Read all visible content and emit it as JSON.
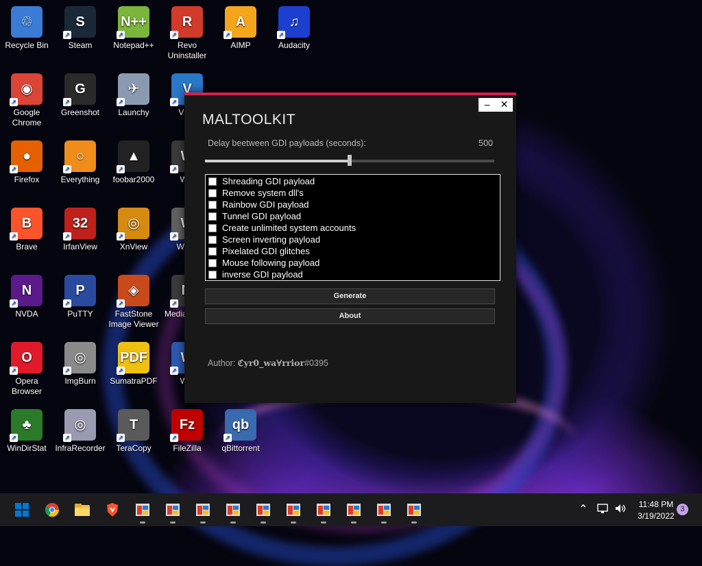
{
  "desktop": {
    "icons": [
      {
        "label": "Recycle Bin",
        "symbol": "♲",
        "color": "#3a7bd5"
      },
      {
        "label": "Steam",
        "symbol": "S",
        "color": "#1b2838"
      },
      {
        "label": "Notepad++",
        "symbol": "N++",
        "color": "#7bb53b"
      },
      {
        "label": "Revo Uninstaller",
        "symbol": "R",
        "color": "#d23a2a"
      },
      {
        "label": "AIMP",
        "symbol": "A",
        "color": "#f4a51c"
      },
      {
        "label": "Audacity",
        "symbol": "♫",
        "color": "#1d3fd0"
      },
      {
        "label": "Google Chrome",
        "symbol": "◉",
        "color": "#db4437"
      },
      {
        "label": "Greenshot",
        "symbol": "G",
        "color": "#2a2a2a"
      },
      {
        "label": "Launchy",
        "symbol": "✈",
        "color": "#8a9ab0"
      },
      {
        "label": "VNC",
        "symbol": "V",
        "color": "#2a78c8"
      },
      {
        "label": "Firefox",
        "symbol": "●",
        "color": "#e66000"
      },
      {
        "label": "Everything",
        "symbol": "○",
        "color": "#f08c1a"
      },
      {
        "label": "foobar2000",
        "symbol": "▲",
        "color": "#222222"
      },
      {
        "label": "Win",
        "symbol": "W",
        "color": "#3a3a3a"
      },
      {
        "label": "Brave",
        "symbol": "B",
        "color": "#fb542b"
      },
      {
        "label": "IrfanView",
        "symbol": "32",
        "color": "#c0201a"
      },
      {
        "label": "XnView",
        "symbol": "◎",
        "color": "#d58a10"
      },
      {
        "label": "WinM",
        "symbol": "W",
        "color": "#606060"
      },
      {
        "label": "NVDA",
        "symbol": "N",
        "color": "#5a1a8a"
      },
      {
        "label": "PuTTY",
        "symbol": "P",
        "color": "#2a4aa0"
      },
      {
        "label": "FastStone Image Viewer",
        "symbol": "◈",
        "color": "#c84a1a"
      },
      {
        "label": "Media Class",
        "symbol": "M",
        "color": "#3a3a3a"
      },
      {
        "label": "Opera Browser",
        "symbol": "O",
        "color": "#e01a2a"
      },
      {
        "label": "ImgBurn",
        "symbol": "◎",
        "color": "#8a8a8a"
      },
      {
        "label": "SumatraPDF",
        "symbol": "PDF",
        "color": "#f0c010"
      },
      {
        "label": "Win",
        "symbol": "W",
        "color": "#2a5ab0"
      },
      {
        "label": "WinDirStat",
        "symbol": "♣",
        "color": "#2a7a2a"
      },
      {
        "label": "InfraRecorder",
        "symbol": "◎",
        "color": "#9a9ab0"
      },
      {
        "label": "TeraCopy",
        "symbol": "T",
        "color": "#5a5a5a"
      },
      {
        "label": "FileZilla",
        "symbol": "Fz",
        "color": "#bf0000"
      },
      {
        "label": "qBittorrent",
        "symbol": "qb",
        "color": "#3a6ab0"
      }
    ]
  },
  "window": {
    "title": "MALTOOLKIT",
    "minimize_label": "–",
    "close_label": "✕",
    "delay_label": "Delay beetween GDI payloads (seconds):",
    "delay_value": "500",
    "slider_fraction": 0.5,
    "options": [
      {
        "label": "Shreading GDI payload",
        "checked": false
      },
      {
        "label": "Remove system dll's",
        "checked": false
      },
      {
        "label": "Rainbow GDI payload",
        "checked": false
      },
      {
        "label": "Tunnel GDI payload",
        "checked": false
      },
      {
        "label": "Create unlimited system accounts",
        "checked": false
      },
      {
        "label": "Screen inverting payload",
        "checked": false
      },
      {
        "label": "Pixelated GDI glitches",
        "checked": false
      },
      {
        "label": "Mouse following payload",
        "checked": false
      },
      {
        "label": "inverse GDI payload",
        "checked": false
      }
    ],
    "generate_label": "Generate",
    "about_label": "About",
    "author_prefix": "Author:",
    "author_name": "ℭyr0_wa∀rrior",
    "author_tag": "#0395"
  },
  "taskbar": {
    "accent": "#0078d4",
    "apps": [
      "start-icon",
      "chrome-icon",
      "file-explorer-icon",
      "brave-icon",
      "app-window-icon",
      "app-window-icon",
      "app-window-icon",
      "app-window-icon",
      "app-window-icon",
      "app-window-icon",
      "app-window-icon",
      "app-window-icon",
      "app-window-icon",
      "app-window-icon"
    ],
    "time": "11:48 PM",
    "date": "3/19/2022",
    "notification_count": "3"
  }
}
